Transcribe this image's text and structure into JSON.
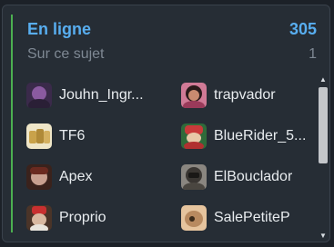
{
  "widget": {
    "title": "En ligne",
    "count": "305",
    "subtitle": "Sur ce sujet",
    "subcount": "1"
  },
  "users": [
    {
      "name": "Jouhn_Ingr...",
      "icon": "avatar-icon",
      "color": "#5a3a66"
    },
    {
      "name": "trapvador",
      "icon": "avatar-icon",
      "color": "#b04a6a"
    },
    {
      "name": "TF6",
      "icon": "avatar-icon",
      "color": "#c9a24a"
    },
    {
      "name": "BlueRider_5...",
      "icon": "avatar-icon",
      "color": "#2f6a3a"
    },
    {
      "name": "Apex",
      "icon": "avatar-icon",
      "color": "#4a2a22"
    },
    {
      "name": "ElBouclador",
      "icon": "avatar-icon",
      "color": "#6a6660"
    },
    {
      "name": "Proprio",
      "icon": "avatar-icon",
      "color": "#5a4030"
    },
    {
      "name": "SalePetiteP",
      "icon": "avatar-icon",
      "color": "#d9a67a"
    }
  ],
  "colors": {
    "accent": "#58aef0",
    "accent_bar": "#4caf50",
    "panel_bg": "#262d35"
  }
}
